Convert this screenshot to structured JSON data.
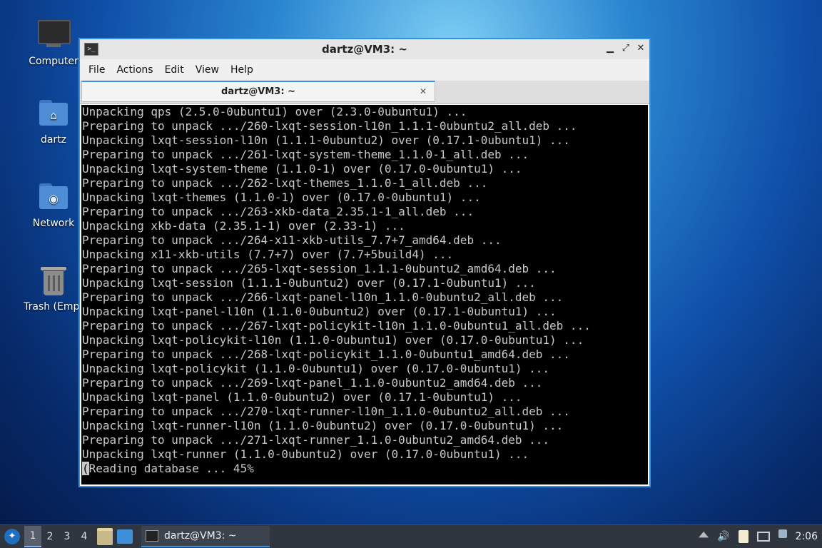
{
  "desktop": {
    "icons": [
      {
        "label": "Computer"
      },
      {
        "label": "dartz"
      },
      {
        "label": "Network"
      },
      {
        "label": "Trash (Empt"
      }
    ]
  },
  "window": {
    "title": "dartz@VM3: ~",
    "menu": [
      "File",
      "Actions",
      "Edit",
      "View",
      "Help"
    ],
    "tab_title": "dartz@VM3: ~",
    "terminal_lines": [
      "Unpacking qps (2.5.0-0ubuntu1) over (2.3.0-0ubuntu1) ...",
      "Preparing to unpack .../260-lxqt-session-l10n_1.1.1-0ubuntu2_all.deb ...",
      "Unpacking lxqt-session-l10n (1.1.1-0ubuntu2) over (0.17.1-0ubuntu1) ...",
      "Preparing to unpack .../261-lxqt-system-theme_1.1.0-1_all.deb ...",
      "Unpacking lxqt-system-theme (1.1.0-1) over (0.17.0-0ubuntu1) ...",
      "Preparing to unpack .../262-lxqt-themes_1.1.0-1_all.deb ...",
      "Unpacking lxqt-themes (1.1.0-1) over (0.17.0-0ubuntu1) ...",
      "Preparing to unpack .../263-xkb-data_2.35.1-1_all.deb ...",
      "Unpacking xkb-data (2.35.1-1) over (2.33-1) ...",
      "Preparing to unpack .../264-x11-xkb-utils_7.7+7_amd64.deb ...",
      "Unpacking x11-xkb-utils (7.7+7) over (7.7+5build4) ...",
      "Preparing to unpack .../265-lxqt-session_1.1.1-0ubuntu2_amd64.deb ...",
      "Unpacking lxqt-session (1.1.1-0ubuntu2) over (0.17.1-0ubuntu1) ...",
      "Preparing to unpack .../266-lxqt-panel-l10n_1.1.0-0ubuntu2_all.deb ...",
      "Unpacking lxqt-panel-l10n (1.1.0-0ubuntu2) over (0.17.1-0ubuntu1) ...",
      "Preparing to unpack .../267-lxqt-policykit-l10n_1.1.0-0ubuntu1_all.deb ...",
      "Unpacking lxqt-policykit-l10n (1.1.0-0ubuntu1) over (0.17.0-0ubuntu1) ...",
      "Preparing to unpack .../268-lxqt-policykit_1.1.0-0ubuntu1_amd64.deb ...",
      "Unpacking lxqt-policykit (1.1.0-0ubuntu1) over (0.17.0-0ubuntu1) ...",
      "Preparing to unpack .../269-lxqt-panel_1.1.0-0ubuntu2_amd64.deb ...",
      "Unpacking lxqt-panel (1.1.0-0ubuntu2) over (0.17.1-0ubuntu1) ...",
      "Preparing to unpack .../270-lxqt-runner-l10n_1.1.0-0ubuntu2_all.deb ...",
      "Unpacking lxqt-runner-l10n (1.1.0-0ubuntu2) over (0.17.0-0ubuntu1) ...",
      "Preparing to unpack .../271-lxqt-runner_1.1.0-0ubuntu2_amd64.deb ...",
      "Unpacking lxqt-runner (1.1.0-0ubuntu2) over (0.17.0-0ubuntu1) ..."
    ],
    "prompt_cursor": "(",
    "prompt_rest": "Reading database ... 45%"
  },
  "taskbar": {
    "workspaces": [
      "1",
      "2",
      "3",
      "4"
    ],
    "active_workspace": "1",
    "task_label": "dartz@VM3: ~",
    "clock": "2:06"
  },
  "colors": {
    "accent": "#3d8fd9",
    "terminal_bg": "#000000",
    "terminal_fg": "#c8c8c8",
    "panel_bg": "#2f3640"
  }
}
